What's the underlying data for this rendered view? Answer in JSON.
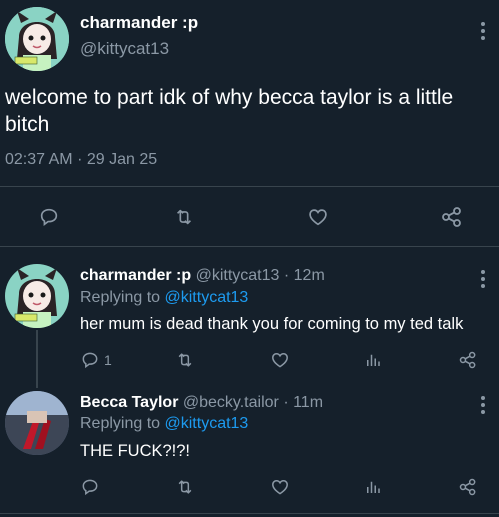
{
  "main_tweet": {
    "display_name": "charmander :p",
    "handle": "@kittycat13",
    "text": "welcome to part idk of why becca taylor is a little bitch",
    "time": "02:37 AM",
    "separator": "·",
    "date": "29 Jan 25"
  },
  "replies": [
    {
      "display_name": "charmander :p",
      "handle": "@kittycat13",
      "age": "12m",
      "separator": "·",
      "replying_prefix": "Replying to",
      "replying_to": "@kittycat13",
      "text": "her mum is dead thank you for coming to my ted talk",
      "reply_count": "1"
    },
    {
      "display_name": "Becca Taylor",
      "handle": "@becky.tailor",
      "age": "11m",
      "separator": "·",
      "replying_prefix": "Replying to",
      "replying_to": "@kittycat13",
      "text": "THE FUCK?!?!",
      "reply_count": ""
    }
  ],
  "colors": {
    "background": "#15202b",
    "muted": "#8b98a5",
    "link": "#1d9bf0",
    "divider": "#38444d"
  },
  "icons": [
    "reply-icon",
    "retweet-icon",
    "like-icon",
    "views-icon",
    "share-icon",
    "more-icon"
  ]
}
